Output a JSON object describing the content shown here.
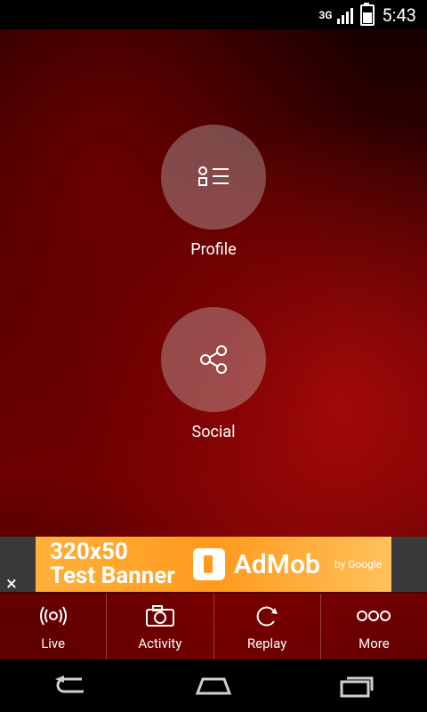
{
  "status_bar": {
    "network": "3G",
    "time": "5:43"
  },
  "menu": {
    "profile": {
      "label": "Profile",
      "icon": "profile-list-icon"
    },
    "social": {
      "label": "Social",
      "icon": "share-icon"
    }
  },
  "ad": {
    "line1": "320x50",
    "line2": "Test Banner",
    "brand": "AdMob",
    "by": "by Google",
    "close": "×"
  },
  "tabs": [
    {
      "label": "Live",
      "icon": "live-broadcast-icon"
    },
    {
      "label": "Activity",
      "icon": "camera-icon"
    },
    {
      "label": "Replay",
      "icon": "replay-icon"
    },
    {
      "label": "More",
      "icon": "more-icon"
    }
  ],
  "nav": [
    {
      "label": "back",
      "icon": "back-icon"
    },
    {
      "label": "home",
      "icon": "home-icon"
    },
    {
      "label": "recent",
      "icon": "recent-apps-icon"
    }
  ]
}
